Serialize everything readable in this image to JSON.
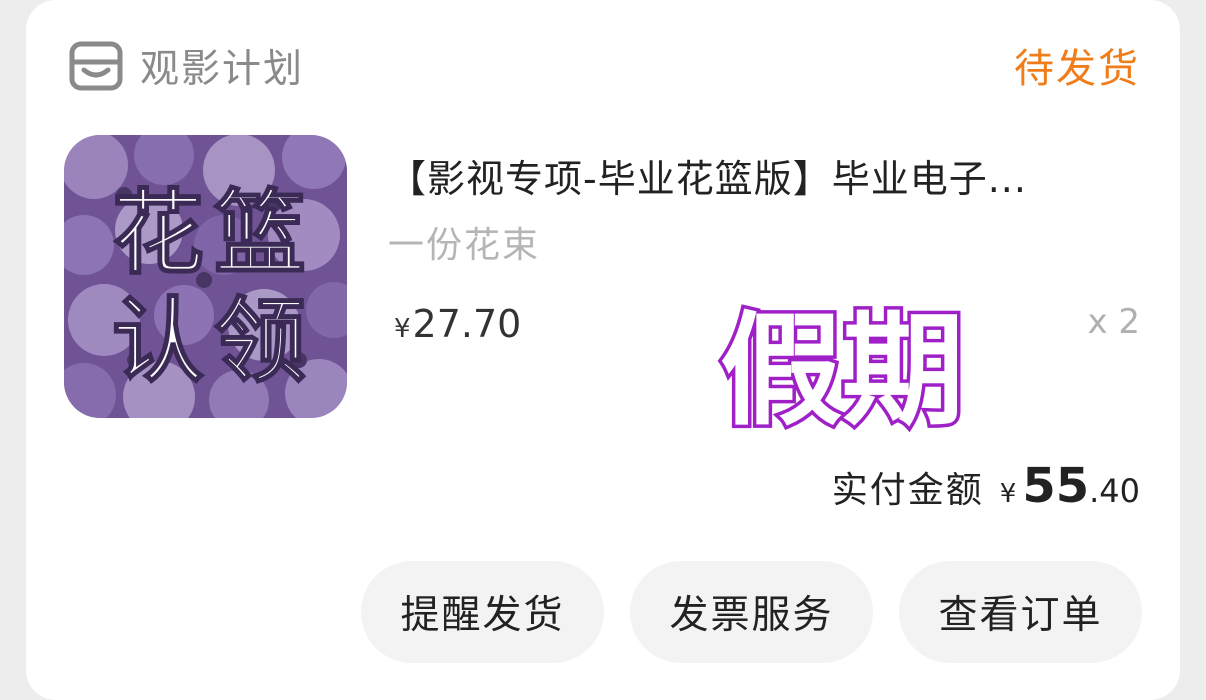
{
  "shop": {
    "name": "观影计划",
    "icon": "shop-icon"
  },
  "order": {
    "status": "待发货",
    "product_title": "【影视专项-毕业花篮版】毕业电子...",
    "product_variant": "一份花束",
    "product_image_text": [
      "花",
      "篮",
      "认",
      "领"
    ],
    "product_image_icon": "purple-flowers-thumbnail",
    "unit_price_currency": "¥",
    "unit_price": "27.70",
    "quantity": "x 2",
    "watermark_text": "假期",
    "total_label": "实付金额",
    "total_currency": "¥",
    "total_integer": "55",
    "total_decimal": ".40"
  },
  "actions": {
    "remind_ship": "提醒发货",
    "invoice": "发票服务",
    "view_order": "查看订单"
  },
  "colors": {
    "status": "#f07d1a",
    "watermark": "#a020c8",
    "background": "#ededed",
    "button_bg": "#f3f3f3"
  }
}
